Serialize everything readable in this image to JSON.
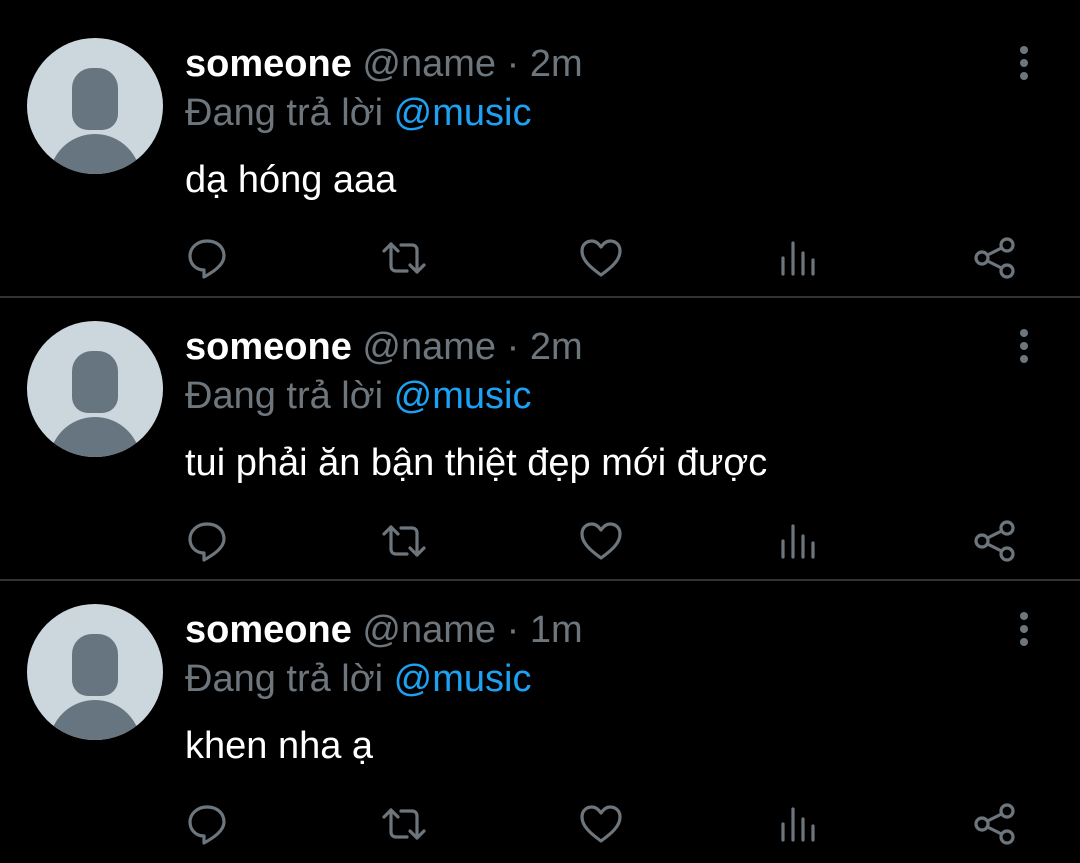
{
  "colors": {
    "background": "#000000",
    "name": "#ffffff",
    "muted": "#6e767d",
    "mention": "#1da1f2",
    "divider": "#2f3336",
    "avatar_bg": "#ccd6dd",
    "avatar_fg": "#66757f"
  },
  "tweets": [
    {
      "name": "someone",
      "handle": "@name",
      "separator": "·",
      "time": "2m",
      "reply_prefix": "Đang trả lời",
      "reply_to": "@music",
      "text": "dạ hóng aaa",
      "icons": [
        "reply-icon",
        "retweet-icon",
        "like-icon",
        "analytics-icon",
        "share-icon"
      ]
    },
    {
      "name": "someone",
      "handle": "@name",
      "separator": "·",
      "time": "2m",
      "reply_prefix": "Đang trả lời",
      "reply_to": "@music",
      "text": "tui phải ăn bận thiệt đẹp mới được",
      "icons": [
        "reply-icon",
        "retweet-icon",
        "like-icon",
        "analytics-icon",
        "share-icon"
      ]
    },
    {
      "name": "someone",
      "handle": "@name",
      "separator": "·",
      "time": "1m",
      "reply_prefix": "Đang trả lời",
      "reply_to": "@music",
      "text": "khen nha ạ",
      "icons": [
        "reply-icon",
        "retweet-icon",
        "like-icon",
        "analytics-icon",
        "share-icon"
      ]
    }
  ]
}
